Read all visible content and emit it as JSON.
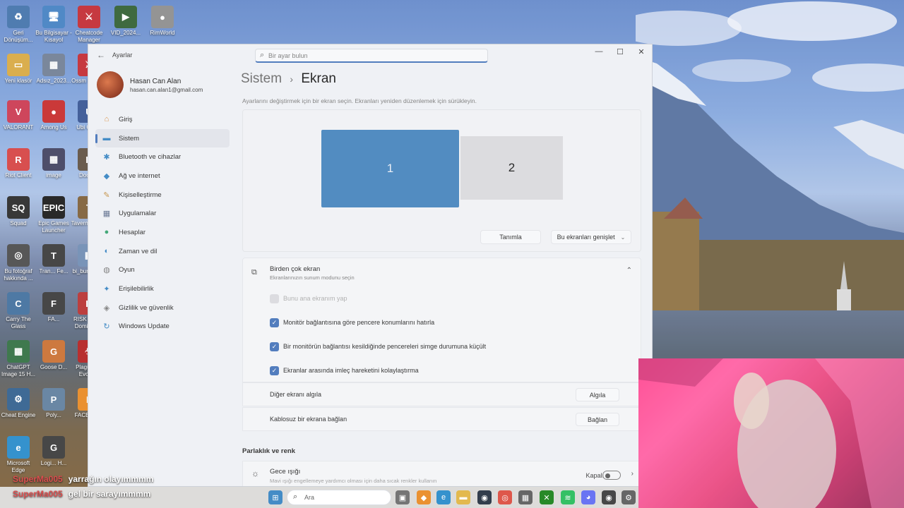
{
  "desktop": {
    "icons": [
      {
        "label": "Geri Dönüşüm...",
        "color": "#3b6ea8",
        "glyph": "♻"
      },
      {
        "label": "Bu Bilgisayar - Kısayol",
        "color": "#3d7cc0",
        "glyph": "🖥"
      },
      {
        "label": "Cheatcode Manager",
        "color": "#c0232b",
        "glyph": "⚔"
      },
      {
        "label": "VID_2024...",
        "color": "#2a5a2a",
        "glyph": "▶"
      },
      {
        "label": "RimWorld",
        "color": "#888888",
        "glyph": "●"
      },
      {
        "label": "Yeni klasör",
        "color": "#d6a53a",
        "glyph": "▭"
      },
      {
        "label": "Adsız_2023...",
        "color": "#6b7a90",
        "glyph": "▦"
      },
      {
        "label": "Ossm Mana...",
        "color": "#c0232b",
        "glyph": "⚔"
      },
      {
        "label": "VALORANT",
        "color": "#c9314a",
        "glyph": "V"
      },
      {
        "label": "Among Us",
        "color": "#c42323",
        "glyph": "●"
      },
      {
        "label": "Ubi Con...",
        "color": "#2f4f8f",
        "glyph": "U"
      },
      {
        "label": "Riot Client",
        "color": "#d43b3b",
        "glyph": "R"
      },
      {
        "label": "image",
        "color": "#3a3a5a",
        "glyph": "▦"
      },
      {
        "label": "Doom...",
        "color": "#5a4a3a",
        "glyph": "D"
      },
      {
        "label": "Squad",
        "color": "#222222",
        "glyph": "SQ"
      },
      {
        "label": "Epic Games Launcher",
        "color": "#111111",
        "glyph": "EPIC"
      },
      {
        "label": "Tavern Master",
        "color": "#7a5a30",
        "glyph": "T"
      },
      {
        "label": "Bu fotoğraf hakkında ...",
        "color": "#444444",
        "glyph": "◎"
      },
      {
        "label": "Tran... Fe...",
        "color": "#333333",
        "glyph": "T"
      },
      {
        "label": "bi_burdan_...",
        "color": "#6a88b0",
        "glyph": "▦"
      },
      {
        "label": "Carry The Glass",
        "color": "#3a6a9a",
        "glyph": "C"
      },
      {
        "label": "FA...",
        "color": "#333333",
        "glyph": "F"
      },
      {
        "label": "RISK Global Domination",
        "color": "#b52a2a",
        "glyph": "R"
      },
      {
        "label": "ChatGPT Image 15 H...",
        "color": "#2a6a3a",
        "glyph": "▦"
      },
      {
        "label": "Goose D...",
        "color": "#c86a2a",
        "glyph": "G"
      },
      {
        "label": "Plague Inc Evolved",
        "color": "#b01818",
        "glyph": "☣"
      },
      {
        "label": "Cheat Engine",
        "color": "#2a5a8a",
        "glyph": "⚙"
      },
      {
        "label": "Poly...",
        "color": "#5a7a9a",
        "glyph": "P"
      },
      {
        "label": "FACEIT AC",
        "color": "#e8851a",
        "glyph": "F"
      },
      {
        "label": "Microsoft Edge",
        "color": "#1f86c8",
        "glyph": "e"
      },
      {
        "label": "Logi... H...",
        "color": "#333333",
        "glyph": "G"
      }
    ]
  },
  "settings": {
    "app_title": "Ayarlar",
    "search_placeholder": "Bir ayar bulun",
    "window_controls": {
      "minimize": "—",
      "maximize": "☐",
      "close": "✕"
    },
    "profile": {
      "name": "Hasan Can Alan",
      "email": "hasan.can.alan1@gmail.com"
    },
    "nav": [
      {
        "label": "Giriş",
        "icon": "home-icon",
        "glyph": "⌂",
        "color": "#d98a3a"
      },
      {
        "label": "Sistem",
        "icon": "system-icon",
        "glyph": "▬",
        "color": "#2f7fc0"
      },
      {
        "label": "Bluetooth ve cihazlar",
        "icon": "bluetooth-icon",
        "glyph": "✱",
        "color": "#2f7fc0"
      },
      {
        "label": "Ağ ve internet",
        "icon": "network-icon",
        "glyph": "◆",
        "color": "#2f7fc0"
      },
      {
        "label": "Kişiselleştirme",
        "icon": "brush-icon",
        "glyph": "✎",
        "color": "#c08a3a"
      },
      {
        "label": "Uygulamalar",
        "icon": "apps-icon",
        "glyph": "▦",
        "color": "#5a6a8a"
      },
      {
        "label": "Hesaplar",
        "icon": "account-icon",
        "glyph": "●",
        "color": "#2f9f6a"
      },
      {
        "label": "Zaman ve dil",
        "icon": "time-language-icon",
        "glyph": "◐",
        "color": "#2f7fc0"
      },
      {
        "label": "Oyun",
        "icon": "gaming-icon",
        "glyph": "◍",
        "color": "#777777"
      },
      {
        "label": "Erişilebilirlik",
        "icon": "accessibility-icon",
        "glyph": "✦",
        "color": "#2f7fc0"
      },
      {
        "label": "Gizlilik ve güvenlik",
        "icon": "shield-icon",
        "glyph": "◈",
        "color": "#777777"
      },
      {
        "label": "Windows Update",
        "icon": "windows-update-icon",
        "glyph": "↻",
        "color": "#2f7fc0"
      }
    ],
    "active_nav_index": 1,
    "breadcrumb": {
      "parent": "Sistem",
      "separator": "›",
      "current": "Ekran"
    },
    "arrange_hint": "Ayarlarını değiştirmek için bir ekran seçin. Ekranları yeniden düzenlemek için sürükleyin.",
    "monitors": {
      "primary": "1",
      "secondary": "2"
    },
    "identify_label": "Tanımla",
    "extend_label": "Bu ekranları genişlet",
    "multi": {
      "title": "Birden çok ekran",
      "subtitle": "Ekranlarınızın sunum modunu seçin",
      "options": [
        {
          "label": "Bunu ana ekranım yap",
          "checked": false,
          "disabled": true
        },
        {
          "label": "Monitör bağlantısına göre pencere konumlarını hatırla",
          "checked": true,
          "disabled": false
        },
        {
          "label": "Bir monitörün bağlantısı kesildiğinde pencereleri simge durumuna küçült",
          "checked": true,
          "disabled": false
        },
        {
          "label": "Ekranlar arasında imleç hareketini kolaylaştırma",
          "checked": true,
          "disabled": false
        }
      ],
      "detect": {
        "label": "Diğer ekranı algıla",
        "button": "Algıla"
      },
      "wireless": {
        "label": "Kablosuz bir ekrana bağlan",
        "button": "Bağlan"
      }
    },
    "brightness_section": "Parlaklık ve renk",
    "night_light": {
      "title": "Gece ışığı",
      "subtitle": "Mavi ışığı engellemeye yardımcı olması için daha sıcak renkler kullanın",
      "state": "Kapalı",
      "on": false
    }
  },
  "chat": [
    {
      "user": "SuperMa005",
      "message": "yarrağın olayımmmm"
    },
    {
      "user": "SuperMa005",
      "message": "gel bir sarayımmmm"
    }
  ],
  "taskbar": {
    "search_placeholder": "Ara",
    "apps": [
      {
        "name": "windows-start-icon",
        "glyph": "⊞",
        "color": "#2f7fc0"
      },
      {
        "name": "task-view-icon",
        "glyph": "▣",
        "color": "#666666"
      },
      {
        "name": "faceit-icon",
        "glyph": "◆",
        "color": "#e8851a"
      },
      {
        "name": "edge-icon",
        "glyph": "e",
        "color": "#1f86c8"
      },
      {
        "name": "file-explorer-icon",
        "glyph": "▬",
        "color": "#e0b13a"
      },
      {
        "name": "steam-icon",
        "glyph": "◉",
        "color": "#1b2838"
      },
      {
        "name": "chrome-icon",
        "glyph": "◎",
        "color": "#db4437"
      },
      {
        "name": "store-icon",
        "glyph": "▦",
        "color": "#555555"
      },
      {
        "name": "xbox-icon",
        "glyph": "✕",
        "color": "#107c10"
      },
      {
        "name": "spotify-icon",
        "glyph": "≋",
        "color": "#1db954"
      },
      {
        "name": "discord-icon",
        "glyph": "◕",
        "color": "#5865f2"
      },
      {
        "name": "obs-icon",
        "glyph": "◉",
        "color": "#333333"
      },
      {
        "name": "settings-icon",
        "glyph": "⚙",
        "color": "#555555"
      }
    ]
  }
}
